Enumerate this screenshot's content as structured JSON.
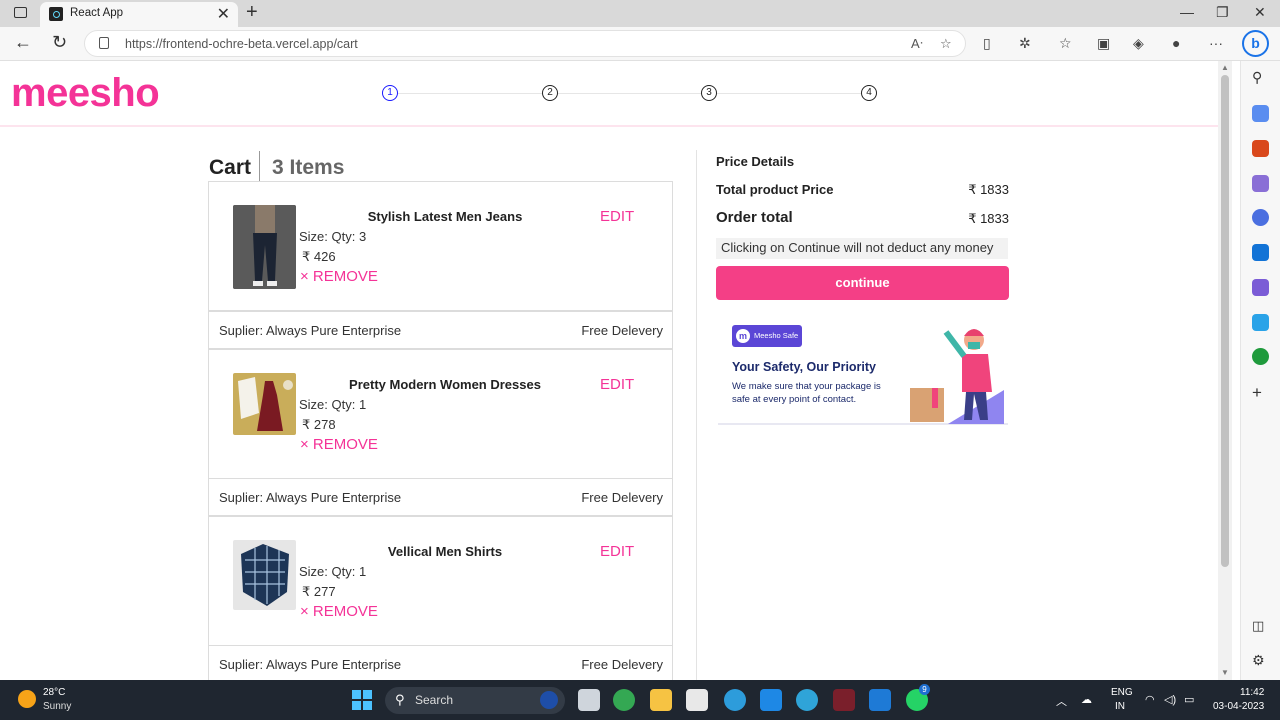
{
  "browser": {
    "tab_title": "React App",
    "url": "https://frontend-ochre-beta.vercel.app/cart"
  },
  "header": {
    "logo": "meesho",
    "steps": [
      "1",
      "2",
      "3",
      "4"
    ]
  },
  "cart": {
    "title": "Cart",
    "count": "3 Items",
    "items": [
      {
        "name": "Stylish Latest Men Jeans",
        "size": "Size: Qty: 3",
        "price": "₹  426",
        "remove": "× REMOVE",
        "edit": "EDIT",
        "supplier": "Suplier: Always Pure Enterprise",
        "delivery": "Free Delevery"
      },
      {
        "name": "Pretty Modern Women Dresses",
        "size": "Size: Qty: 1",
        "price": "₹  278",
        "remove": "× REMOVE",
        "edit": "EDIT",
        "supplier": "Suplier: Always Pure Enterprise",
        "delivery": "Free Delevery"
      },
      {
        "name": "Vellical Men Shirts",
        "size": "Size: Qty: 1",
        "price": "₹  277",
        "remove": "× REMOVE",
        "edit": "EDIT",
        "supplier": "Suplier: Always Pure Enterprise",
        "delivery": "Free Delevery"
      }
    ]
  },
  "price_details": {
    "title": "Price Details",
    "total_label": "Total product Price",
    "total_value": "₹ 1833",
    "order_label": "Order total",
    "order_value": "₹ 1833",
    "note": "Clicking on Continue will not deduct any money",
    "continue": "continue"
  },
  "safety": {
    "badge": "Meesho Safe",
    "heading": "Your Safety, Our Priority",
    "text": "We make sure that your package is safe at every point of contact."
  },
  "taskbar": {
    "temp": "28°C",
    "weather": "Sunny",
    "search": "Search",
    "lang1": "ENG",
    "lang2": "IN",
    "time": "11:42",
    "date": "03-04-2023",
    "badge": "9"
  },
  "colors": {
    "brand": "#f43397",
    "button": "#f43f86",
    "active_step": "#1a1aff"
  }
}
